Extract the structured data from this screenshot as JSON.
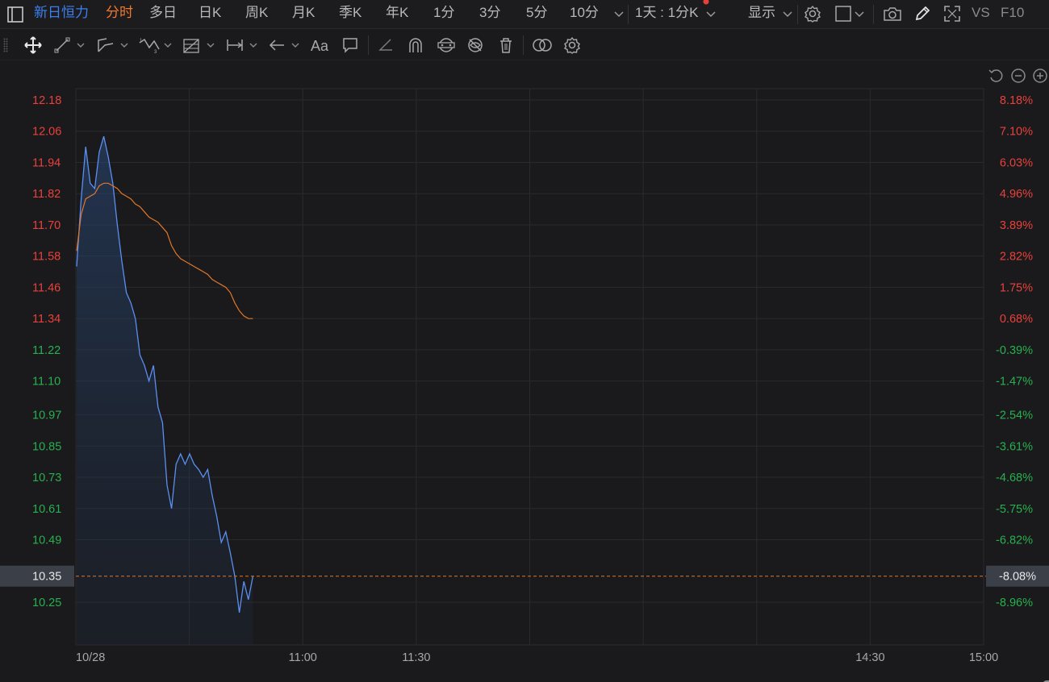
{
  "topbar": {
    "stock_name": "新日恒力",
    "tabs": [
      "分时",
      "多日",
      "日K",
      "周K",
      "月K",
      "季K",
      "年K",
      "1分",
      "3分",
      "5分",
      "10分"
    ],
    "period_select": "1天 : 1分K",
    "display_menu": "显示",
    "vs_label": "VS",
    "f10_label": "F10"
  },
  "chart": {
    "price_ticks": [
      "12.18",
      "12.06",
      "11.94",
      "11.82",
      "11.70",
      "11.58",
      "11.46",
      "11.34",
      "11.22",
      "11.10",
      "10.97",
      "10.85",
      "10.73",
      "10.61",
      "10.49",
      "10.25"
    ],
    "pct_ticks": [
      "8.18%",
      "7.10%",
      "6.03%",
      "4.96%",
      "3.89%",
      "2.82%",
      "1.75%",
      "0.68%",
      "-0.39%",
      "-1.47%",
      "-2.54%",
      "-3.61%",
      "-4.68%",
      "-5.75%",
      "-6.82%",
      "-8.96%"
    ],
    "current_price": "10.35",
    "current_pct": "-8.08%",
    "time_labels": [
      "10/28",
      "11:00",
      "11:30",
      "14:30",
      "15:00"
    ],
    "colors": {
      "up": "#e8413c",
      "down": "#28b04f",
      "price_line": "#5b8ff0",
      "avg_line": "#e0762a",
      "dash_line": "#e0762a"
    }
  },
  "chart_data": {
    "type": "line",
    "x_range": [
      "09:30",
      "15:00"
    ],
    "ylim": [
      10.18,
      12.24
    ],
    "prev_close": 11.26,
    "series": [
      {
        "values": [
          11.54,
          11.8,
          12.0,
          11.86,
          11.84,
          11.98,
          12.04,
          11.96,
          11.86,
          11.7,
          11.56,
          11.44,
          11.4,
          11.34,
          11.2,
          11.16,
          11.1,
          11.16,
          11.0,
          10.94,
          10.7,
          10.61,
          10.78,
          10.82,
          10.78,
          10.82,
          10.78,
          10.76,
          10.73,
          10.76,
          10.66,
          10.58,
          10.48,
          10.52,
          10.44,
          10.35,
          10.21,
          10.33,
          10.26,
          10.35
        ]
      },
      {
        "values": [
          11.6,
          11.74,
          11.8,
          11.81,
          11.82,
          11.85,
          11.86,
          11.86,
          11.85,
          11.84,
          11.82,
          11.81,
          11.8,
          11.78,
          11.77,
          11.75,
          11.73,
          11.72,
          11.71,
          11.69,
          11.67,
          11.62,
          11.59,
          11.57,
          11.56,
          11.55,
          11.54,
          11.53,
          11.52,
          11.51,
          11.49,
          11.48,
          11.47,
          11.46,
          11.44,
          11.4,
          11.37,
          11.35,
          11.34,
          11.34
        ]
      }
    ]
  }
}
